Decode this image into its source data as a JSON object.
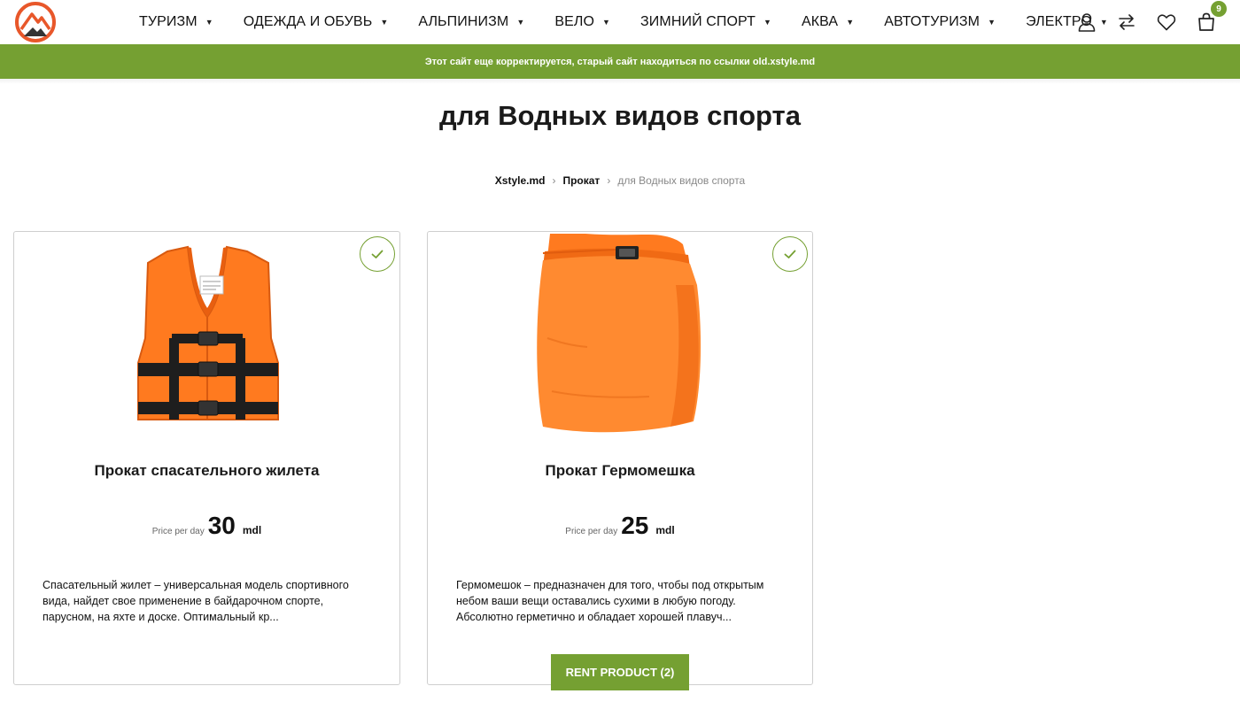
{
  "header": {
    "logo_icon": "mountain-logo-icon",
    "nav": [
      {
        "label": "ТУРИЗМ"
      },
      {
        "label": "ОДЕЖДА И ОБУВЬ"
      },
      {
        "label": "АЛЬПИНИЗМ"
      },
      {
        "label": "ВЕЛО"
      },
      {
        "label": "ЗИМНИЙ СПОРТ"
      },
      {
        "label": "АКВА"
      },
      {
        "label": "АВТОТУРИЗМ"
      },
      {
        "label": "ЭЛЕКТРО"
      }
    ],
    "cart_count": "9"
  },
  "notice": "Этот сайт еще корректируется, старый сайт находиться по ссылки old.xstyle.md",
  "page": {
    "title": "для Водных видов спорта",
    "breadcrumb": [
      "Xstyle.md",
      "Прокат",
      "для Водных видов спорта"
    ]
  },
  "products": [
    {
      "title": "Прокат спасательного жилета",
      "price_label": "Price per day",
      "price": "30",
      "currency": "mdl",
      "description": "Спасательный жилет – универсальная модель спортивного вида, найдет свое применение в байдарочном спорте, парусном, на яхте и доске. Оптимальный кр..."
    },
    {
      "title": "Прокат Гермомешка",
      "price_label": "Price per day",
      "price": "25",
      "currency": "mdl",
      "description": "Гермомешок – предназначен для того, чтобы под открытым небом ваши вещи оставались сухими в любую погоду. Абсолютно герметично и обладает хорошей плавуч..."
    }
  ],
  "rent_button": "RENT PRODUCT (2)",
  "colors": {
    "accent": "#75a032",
    "logo_orange": "#e8572a",
    "product_orange": "#ff7a1f"
  }
}
